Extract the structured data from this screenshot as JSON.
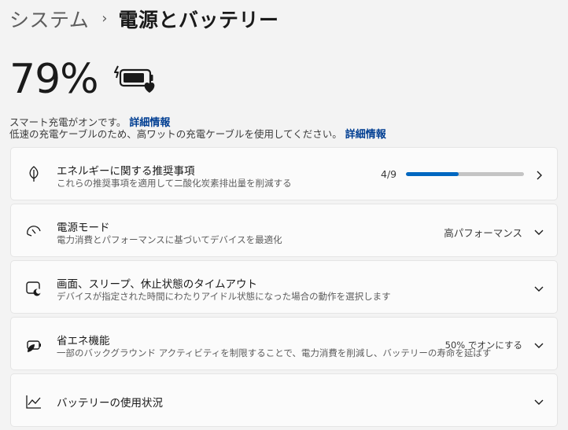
{
  "breadcrumb": {
    "parent": "システム",
    "separator": "›",
    "current": "電源とバッテリー"
  },
  "battery": {
    "percent_text": "79%",
    "icon": "battery-charging-heart-icon",
    "level": 0.79
  },
  "info": {
    "smart_charging_text": "スマート充電がオンです。",
    "smart_charging_link": "詳細情報",
    "slow_charger_text": "低速の充電ケーブルのため、高ワットの充電ケーブルを使用してください。",
    "slow_charger_link": "詳細情報"
  },
  "cards": [
    {
      "title": "エネルギーに関する推奨事項",
      "desc": "これらの推奨事項を適用して二酸化炭素排出量を削減する",
      "value": "4/9",
      "progress": 0.444,
      "icon": "leaf-icon",
      "chevron": "chevron-right-icon"
    },
    {
      "title": "電源モード",
      "desc": "電力消費とパフォーマンスに基づいてデバイスを最適化",
      "value": "高パフォーマンス",
      "icon": "power-mode-gauge-icon",
      "chevron": "chevron-down-icon"
    },
    {
      "title": "画面、スリープ、休止状態のタイムアウト",
      "desc": "デバイスが指定された時間にわたりアイドル状態になった場合の動作を選択します",
      "icon": "screen-sleep-icon",
      "chevron": "chevron-down-icon"
    },
    {
      "title": "省エネ機能",
      "desc": "一部のバックグラウンド アクティビティを制限することで、電力消費を削減し、バッテリーの寿命を延ばす",
      "value": "50% でオンにする",
      "icon": "energy-saver-icon",
      "chevron": "chevron-down-icon"
    },
    {
      "title": "バッテリーの使用状況",
      "icon": "usage-chart-icon",
      "chevron": "chevron-down-icon"
    }
  ],
  "colors": {
    "accent": "#0067c0",
    "link": "#003e92",
    "background": "#f3f3f3",
    "card": "#fbfbfb"
  }
}
